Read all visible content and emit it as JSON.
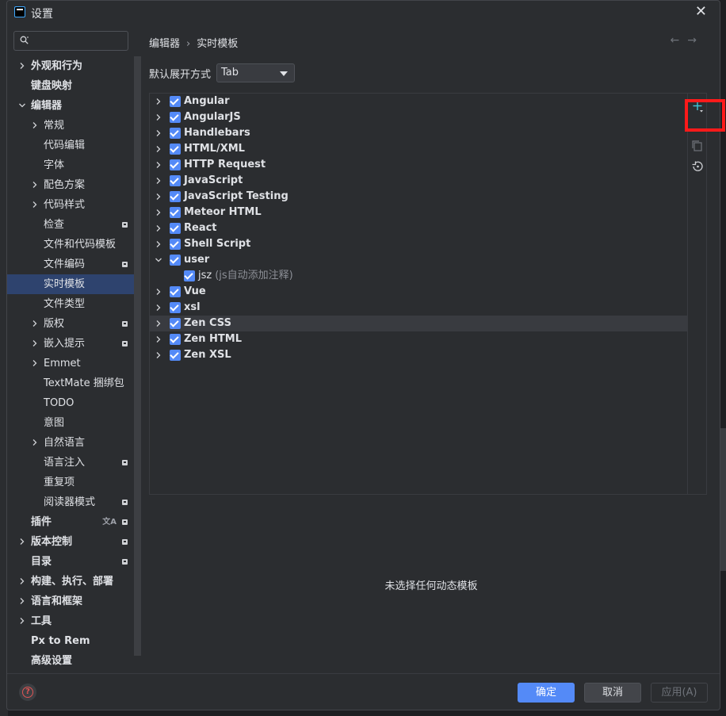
{
  "window": {
    "title": "设置",
    "close_label": "✕"
  },
  "search": {
    "placeholder": ""
  },
  "sidebar": {
    "items": [
      {
        "label": "外观和行为",
        "level": 0,
        "chevron": "right",
        "bold": true
      },
      {
        "label": "键盘映射",
        "level": 0,
        "chevron": "none",
        "bold": true
      },
      {
        "label": "编辑器",
        "level": 0,
        "chevron": "down",
        "bold": true
      },
      {
        "label": "常规",
        "level": 1,
        "chevron": "right"
      },
      {
        "label": "代码编辑",
        "level": 1,
        "chevron": "none"
      },
      {
        "label": "字体",
        "level": 1,
        "chevron": "none"
      },
      {
        "label": "配色方案",
        "level": 1,
        "chevron": "right"
      },
      {
        "label": "代码样式",
        "level": 1,
        "chevron": "right"
      },
      {
        "label": "检查",
        "level": 1,
        "chevron": "none",
        "badge": true
      },
      {
        "label": "文件和代码模板",
        "level": 1,
        "chevron": "none"
      },
      {
        "label": "文件编码",
        "level": 1,
        "chevron": "none",
        "badge": true
      },
      {
        "label": "实时模板",
        "level": 1,
        "chevron": "none",
        "selected": true
      },
      {
        "label": "文件类型",
        "level": 1,
        "chevron": "none"
      },
      {
        "label": "版权",
        "level": 1,
        "chevron": "right",
        "badge": true
      },
      {
        "label": "嵌入提示",
        "level": 1,
        "chevron": "right",
        "badge": true
      },
      {
        "label": "Emmet",
        "level": 1,
        "chevron": "right"
      },
      {
        "label": "TextMate 捆绑包",
        "level": 1,
        "chevron": "none"
      },
      {
        "label": "TODO",
        "level": 1,
        "chevron": "none"
      },
      {
        "label": "意图",
        "level": 1,
        "chevron": "none"
      },
      {
        "label": "自然语言",
        "level": 1,
        "chevron": "right"
      },
      {
        "label": "语言注入",
        "level": 1,
        "chevron": "none",
        "badge": true
      },
      {
        "label": "重复项",
        "level": 1,
        "chevron": "none"
      },
      {
        "label": "阅读器模式",
        "level": 1,
        "chevron": "none",
        "badge": true
      },
      {
        "label": "插件",
        "level": 0,
        "chevron": "none",
        "bold": true,
        "badge": true,
        "translate": true
      },
      {
        "label": "版本控制",
        "level": 0,
        "chevron": "right",
        "bold": true,
        "badge": true
      },
      {
        "label": "目录",
        "level": 0,
        "chevron": "none",
        "bold": true,
        "badge": true
      },
      {
        "label": "构建、执行、部署",
        "level": 0,
        "chevron": "right",
        "bold": true
      },
      {
        "label": "语言和框架",
        "level": 0,
        "chevron": "right",
        "bold": true
      },
      {
        "label": "工具",
        "level": 0,
        "chevron": "right",
        "bold": true
      },
      {
        "label": "Px to Rem",
        "level": 0,
        "chevron": "none",
        "bold": true
      },
      {
        "label": "高级设置",
        "level": 0,
        "chevron": "none",
        "bold": true
      }
    ]
  },
  "breadcrumb": {
    "parent": "编辑器",
    "separator": "›",
    "current": "实时模板"
  },
  "expand": {
    "label": "默认展开方式",
    "value": "Tab"
  },
  "templates": [
    {
      "name": "Angular",
      "expanded": false,
      "checked": true
    },
    {
      "name": "AngularJS",
      "expanded": false,
      "checked": true
    },
    {
      "name": "Handlebars",
      "expanded": false,
      "checked": true
    },
    {
      "name": "HTML/XML",
      "expanded": false,
      "checked": true
    },
    {
      "name": "HTTP Request",
      "expanded": false,
      "checked": true
    },
    {
      "name": "JavaScript",
      "expanded": false,
      "checked": true
    },
    {
      "name": "JavaScript Testing",
      "expanded": false,
      "checked": true
    },
    {
      "name": "Meteor HTML",
      "expanded": false,
      "checked": true
    },
    {
      "name": "React",
      "expanded": false,
      "checked": true
    },
    {
      "name": "Shell Script",
      "expanded": false,
      "checked": true
    },
    {
      "name": "user",
      "expanded": true,
      "checked": true
    },
    {
      "name": "jsz",
      "desc": "(js自动添加注释)",
      "child": true,
      "checked": true
    },
    {
      "name": "Vue",
      "expanded": false,
      "checked": true
    },
    {
      "name": "xsl",
      "expanded": false,
      "checked": true
    },
    {
      "name": "Zen CSS",
      "expanded": false,
      "checked": true,
      "hover": true
    },
    {
      "name": "Zen HTML",
      "expanded": false,
      "checked": true
    },
    {
      "name": "Zen XSL",
      "expanded": false,
      "checked": true
    }
  ],
  "toolbar": {
    "add_icon": "plus-icon",
    "copy_icon": "copy-icon",
    "restore_icon": "restore-icon"
  },
  "empty_message": "未选择任何动态模板",
  "footer": {
    "help": "?",
    "ok": "确定",
    "cancel": "取消",
    "apply": "应用(A)"
  },
  "colors": {
    "accent": "#548af7",
    "selected": "#2e436e",
    "highlight": "#ff1a1a",
    "background": "#2b2d30"
  }
}
